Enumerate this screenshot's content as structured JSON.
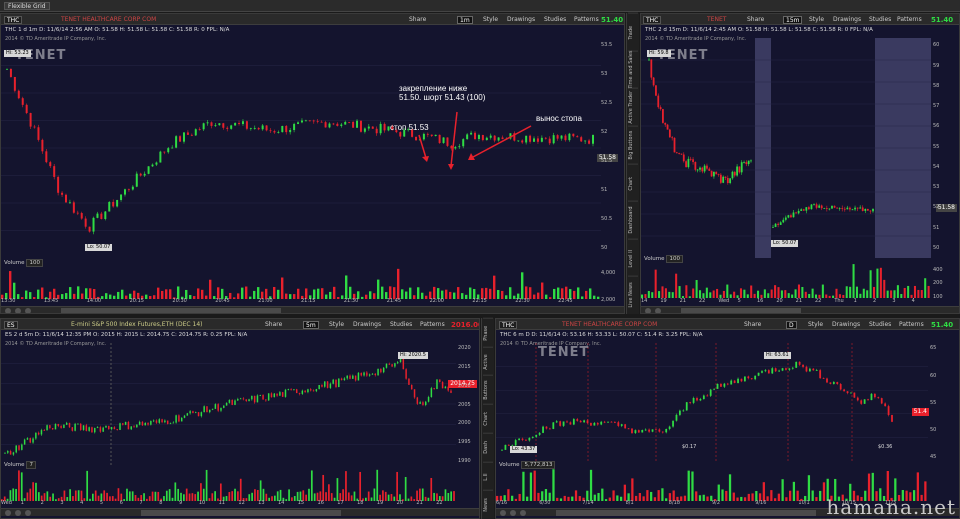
{
  "app": {
    "tab_label": "Flexible Grid"
  },
  "colors": {
    "up": "#2fdc44",
    "down": "#e8212c",
    "bg": "#14142e",
    "brand_red": "#c44"
  },
  "panels": {
    "tl": {
      "symbol": "THC",
      "company": "TENET HEALTHCARE CORP COM",
      "timeframe": "1m",
      "price": "51.40",
      "info": "THC 1 d 1m   D: 11/6/14 2:56 AM  O: 51.58  H: 51.58  L: 51.58  C: 51.58  R: 0  FPL: N/A",
      "copyright": "2014 © TD Ameritrade IP Company, Inc.",
      "watermark": "TENET",
      "hi_tag": "Hi: 53.23",
      "lo_tag": "Lo: 50.07",
      "last_tag": "51.58",
      "yticks": [
        "53.5",
        "53",
        "52.5",
        "52",
        "51.5",
        "51",
        "50.5",
        "50"
      ],
      "xticks": [
        "13:30",
        "13:45",
        "14:00",
        "20:15",
        "20:30",
        "20:45",
        "21:00",
        "21:15",
        "21:30",
        "21:45",
        "22:00",
        "22:15",
        "22:30",
        "22:45"
      ],
      "volume_label": "Volume",
      "volume_value": "100",
      "vticks": [
        "4,000",
        "2,000"
      ],
      "annotations": {
        "a1": "закрепление ниже",
        "a2": "51.50.  шорт 51.43 (100)",
        "a3": "стоп 51.53",
        "a4": "вынос стопа"
      }
    },
    "tr": {
      "symbol": "THC",
      "company": "TENET",
      "timeframe": "15m",
      "price": "51.40",
      "info": "THC 2 d 15m  D: 11/6/14 2:45 AM  O: 51.58  H: 51.58  L: 51.58  C: 51.58  R: 0  FPL: N/A",
      "copyright": "2014 © TD Ameritrade IP Company, Inc.",
      "watermark": "TENET",
      "hi_tag": "Hi: 59.8",
      "lo_tag": "Lo: 50.07",
      "last_tag": "51.58",
      "yticks": [
        "60",
        "59",
        "58",
        "57",
        "56",
        "55",
        "54",
        "53",
        "52",
        "51",
        "50"
      ],
      "xticks": [
        "14",
        "19",
        "21",
        "22",
        "Wed",
        "5",
        "16",
        "20",
        "21",
        "22",
        "Thu",
        "1",
        "2",
        "3",
        "4"
      ],
      "volume_label": "Volume",
      "volume_value": "100",
      "vticks": [
        "400",
        "200",
        "100"
      ]
    },
    "bl": {
      "symbol": "ES",
      "company": "E-mini S&P 500 Index Futures,ETH (DEC 14)",
      "timeframe": "5m",
      "price": "2016.00",
      "info": "ES 2 d 5m   D: 11/6/14 12:35 PM  O: 2015  H: 2015  L: 2014.75  C: 2014.75  R: 0.25  FPL: N/A",
      "copyright": "2014 © TD Ameritrade IP Company, Inc.",
      "hi_tag": "Hi: 2020.5",
      "last_tag": "2014.75",
      "yticks": [
        "2020",
        "2015",
        "2010",
        "2005",
        "2000",
        "1995",
        "1990"
      ],
      "xticks": [
        "Wed",
        "1",
        "2",
        "3",
        "4",
        "5",
        "6",
        "7",
        "8",
        "9",
        "10",
        "11",
        "12",
        "13",
        "14",
        "15",
        "16",
        "17",
        "18",
        "19",
        "20",
        "21",
        "22"
      ],
      "volume_label": "Volume",
      "volume_value": "7",
      "vticks": [
        "60,000",
        "40,000",
        "20,000"
      ]
    },
    "br": {
      "symbol": "THC",
      "company": "TENET HEALTHCARE CORP COM",
      "timeframe": "D",
      "price": "51.40",
      "info": "THC 6 m D  D: 11/6/14  O: 53.16  H: 53.33  L: 50.07  C: 51.4  R: 3.25  FPL: N/A",
      "copyright": "2014 © TD Ameritrade IP Company, Inc.",
      "watermark": "TENET",
      "hi_tag": "Hi: 63.61",
      "lo_tag": "Lo: 43.37",
      "last_tag": "51.4",
      "yticks": [
        "65",
        "60",
        "55",
        "50",
        "45"
      ],
      "xticks": [
        "6/16",
        "6/30",
        "7/14",
        "8/1",
        "8/18",
        "9/2",
        "9/16",
        "10/1",
        "10/15",
        "11/3"
      ],
      "volume_label": "Volume",
      "volume_value": "5,772,813",
      "vticks": [
        "4,000,000",
        "2,000,000"
      ],
      "div1": "$0.17",
      "div2": "$0.36"
    }
  },
  "toolbar": {
    "share": "Share",
    "style": "Style",
    "drawings": "Drawings",
    "studies": "Studies",
    "patterns": "Patterns"
  },
  "side_tabs": [
    "Trade",
    "Time and Sales",
    "Active Trader",
    "Big Buttons",
    "Chart",
    "Dashboard",
    "Level II",
    "Live News"
  ],
  "side_tabs_b": [
    "Phase",
    "Active",
    "Buttons",
    "Chart",
    "Dash",
    "L.II",
    "News"
  ],
  "credit": "hamana.net"
}
